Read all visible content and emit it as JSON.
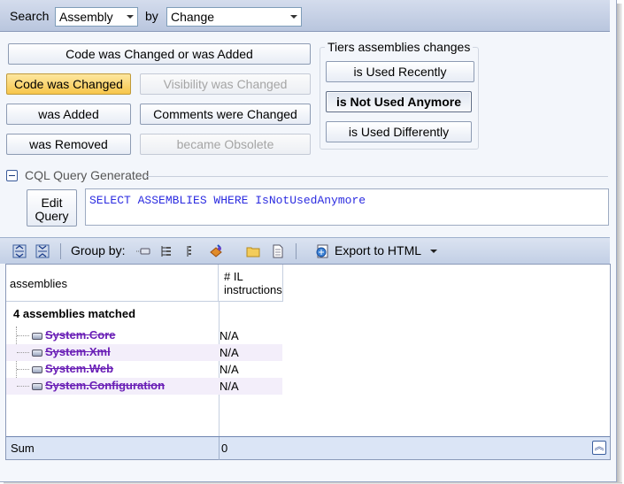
{
  "search": {
    "label": "Search",
    "target_value": "Assembly",
    "by_label": "by",
    "criteria_value": "Change"
  },
  "buttons": {
    "changed_or_added": "Code was Changed or was Added",
    "code_changed": "Code was Changed",
    "visibility_changed": "Visibility was Changed",
    "was_added": "was Added",
    "comments_changed": "Comments were Changed",
    "was_removed": "was Removed",
    "became_obsolete": "became Obsolete"
  },
  "tiers": {
    "title": "Tiers assemblies changes",
    "used_recently": "is Used Recently",
    "not_used_anymore": "is Not Used Anymore",
    "used_differently": "is Used Differently"
  },
  "cql": {
    "section_title": "CQL Query Generated",
    "edit_line1": "Edit",
    "edit_line2": "Query",
    "query_text": "SELECT ASSEMBLIES WHERE IsNotUsedAnymore"
  },
  "toolbar": {
    "group_by_label": "Group by:",
    "export_label": "Export to HTML"
  },
  "grid": {
    "col1_header": "assemblies",
    "col2_header_line1": "# IL",
    "col2_header_line2": "instructions",
    "matched_label": "4 assemblies matched",
    "rows": [
      {
        "name": "System.Core",
        "value": "N/A"
      },
      {
        "name": "System.Xml",
        "value": "N/A"
      },
      {
        "name": "System.Web",
        "value": "N/A"
      },
      {
        "name": "System.Configuration",
        "value": "N/A"
      }
    ],
    "sum_label": "Sum",
    "sum_value": "0"
  },
  "colors": {
    "active_button": "#f7c64b",
    "removed_item": "#6a1fb6",
    "query_text": "#2b2be0"
  }
}
